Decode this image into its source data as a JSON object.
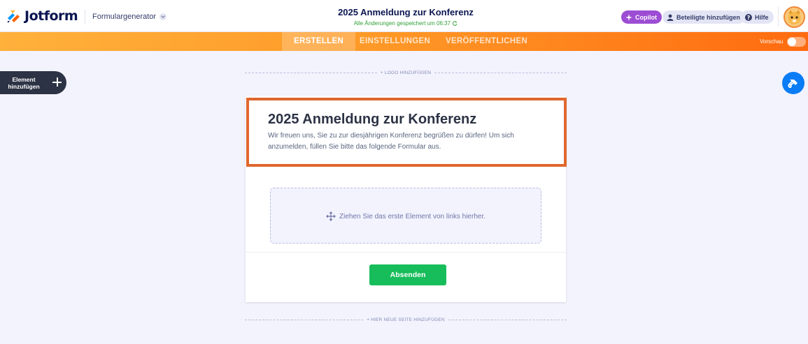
{
  "brand": {
    "name": "Jotform",
    "product": "Formulargenerator"
  },
  "document": {
    "title": "2025 Anmeldung zur Konferenz",
    "save_status": "Alle Änderungen gespeichert um 06:37"
  },
  "header_buttons": {
    "copilot": "Copilot",
    "invite": "Beteiligte hinzufügen",
    "help": "Hilfe"
  },
  "nav": {
    "tabs": [
      "ERSTELLEN",
      "EINSTELLUNGEN",
      "VERÖFFENTLICHEN"
    ],
    "active_tab": "ERSTELLEN",
    "preview_label": "Vorschau"
  },
  "sidebar": {
    "add_element_label": "Element hinzufügen"
  },
  "canvas": {
    "add_logo": "+ LOGO HINZUFÜGEN",
    "add_page": "+ HIER NEUE SEITE HINZUFÜGEN"
  },
  "form": {
    "heading": "2025 Anmeldung zur Konferenz",
    "subheading": "Wir freuen uns, Sie zu zur diesjährigen Konferenz begrüßen zu dürfen! Um sich anzumelden, füllen Sie bitte das folgende Formular aus.",
    "dropzone_hint": "Ziehen Sie das erste Element von links hierher.",
    "submit_label": "Absenden"
  },
  "colors": {
    "brand_orange": "#ff6b10",
    "highlight_border": "#e0672e",
    "submit_green": "#18bd5b",
    "copilot_purple": "#9c4dd3",
    "designer_blue": "#0a7cf5"
  },
  "icons": {
    "logo": "jotform-logo-icon",
    "copilot": "sparkle-icon",
    "invite": "user-icon",
    "help": "question-icon",
    "designer": "paint-roller-icon",
    "move": "move-arrows-icon",
    "refresh": "refresh-icon"
  }
}
